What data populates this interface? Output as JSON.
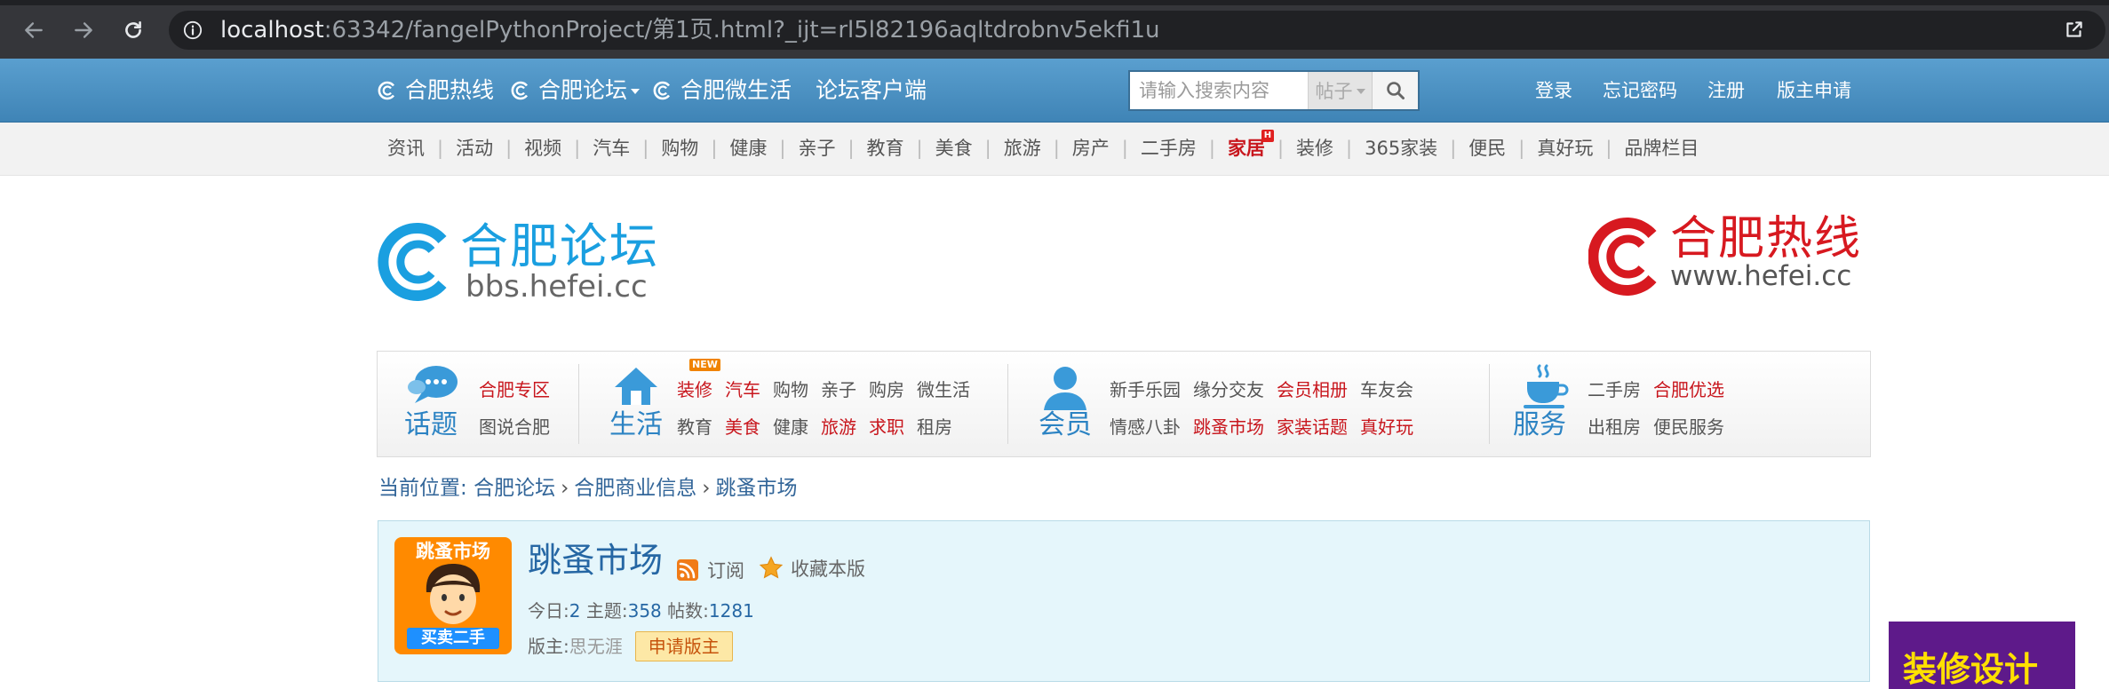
{
  "browser": {
    "url_host": "localhost",
    "url_rest": ":63342/fangelPythonProject/第1页.html?_ijt=rl5l82196aqltdrobnv5ekfi1u"
  },
  "topbar": {
    "links": [
      "合肥热线",
      "合肥论坛",
      "合肥微生活",
      "论坛客户端"
    ],
    "search_placeholder": "请输入搜索内容",
    "search_type": "帖子",
    "right_links": [
      "登录",
      "忘记密码",
      "注册",
      "版主申请"
    ]
  },
  "channels": {
    "items": [
      "资讯",
      "活动",
      "视频",
      "汽车",
      "购物",
      "健康",
      "亲子",
      "教育",
      "美食",
      "旅游",
      "房产",
      "二手房",
      "家居",
      "装修",
      "365家装",
      "便民",
      "真好玩",
      "品牌栏目"
    ],
    "highlight": "家居",
    "badge": "H"
  },
  "logo_left": {
    "title": "合肥论坛",
    "sub": "bbs.hefei.cc"
  },
  "logo_right": {
    "title": "合肥热线",
    "sub": "www.hefei.cc"
  },
  "catnav": {
    "topic": {
      "label": "话题",
      "row1": [
        "合肥专区"
      ],
      "row2": [
        "图说合肥"
      ]
    },
    "life": {
      "label": "生活",
      "row1": [
        "装修",
        "汽车",
        "购物",
        "亲子",
        "购房",
        "微生活"
      ],
      "row2": [
        "教育",
        "美食",
        "健康",
        "旅游",
        "求职",
        "租房"
      ],
      "new_badge": "NEW"
    },
    "member": {
      "label": "会员",
      "row1": [
        "新手乐园",
        "缘分交友",
        "会员相册",
        "车友会"
      ],
      "row2": [
        "情感八卦",
        "跳蚤市场",
        "家装话题",
        "真好玩"
      ]
    },
    "service": {
      "label": "服务",
      "row1": [
        "二手房",
        "合肥优选"
      ],
      "row2": [
        "出租房",
        "便民服务"
      ]
    }
  },
  "breadcrumb": {
    "prefix": "当前位置:",
    "items": [
      "合肥论坛",
      "合肥商业信息",
      "跳蚤市场"
    ]
  },
  "forum": {
    "avatar_top": "跳蚤市场",
    "avatar_bottom": "买卖二手",
    "title": "跳蚤市场",
    "subscribe": "订阅",
    "favorite": "收藏本版",
    "today_label": "今日:",
    "today": "2",
    "topics_label": "主题:",
    "topics": "358",
    "posts_label": "帖数:",
    "posts": "1281",
    "mod_label": "版主:",
    "mod_name": "思无涯",
    "apply": "申请版主"
  },
  "ad": {
    "text": "装修设计"
  },
  "colors": {
    "topbar": "#4b90c2",
    "brand_blue": "#1a9fe0",
    "brand_red": "#d71920",
    "link_red": "#c8161d",
    "forum_bg": "#e5f6fb"
  }
}
